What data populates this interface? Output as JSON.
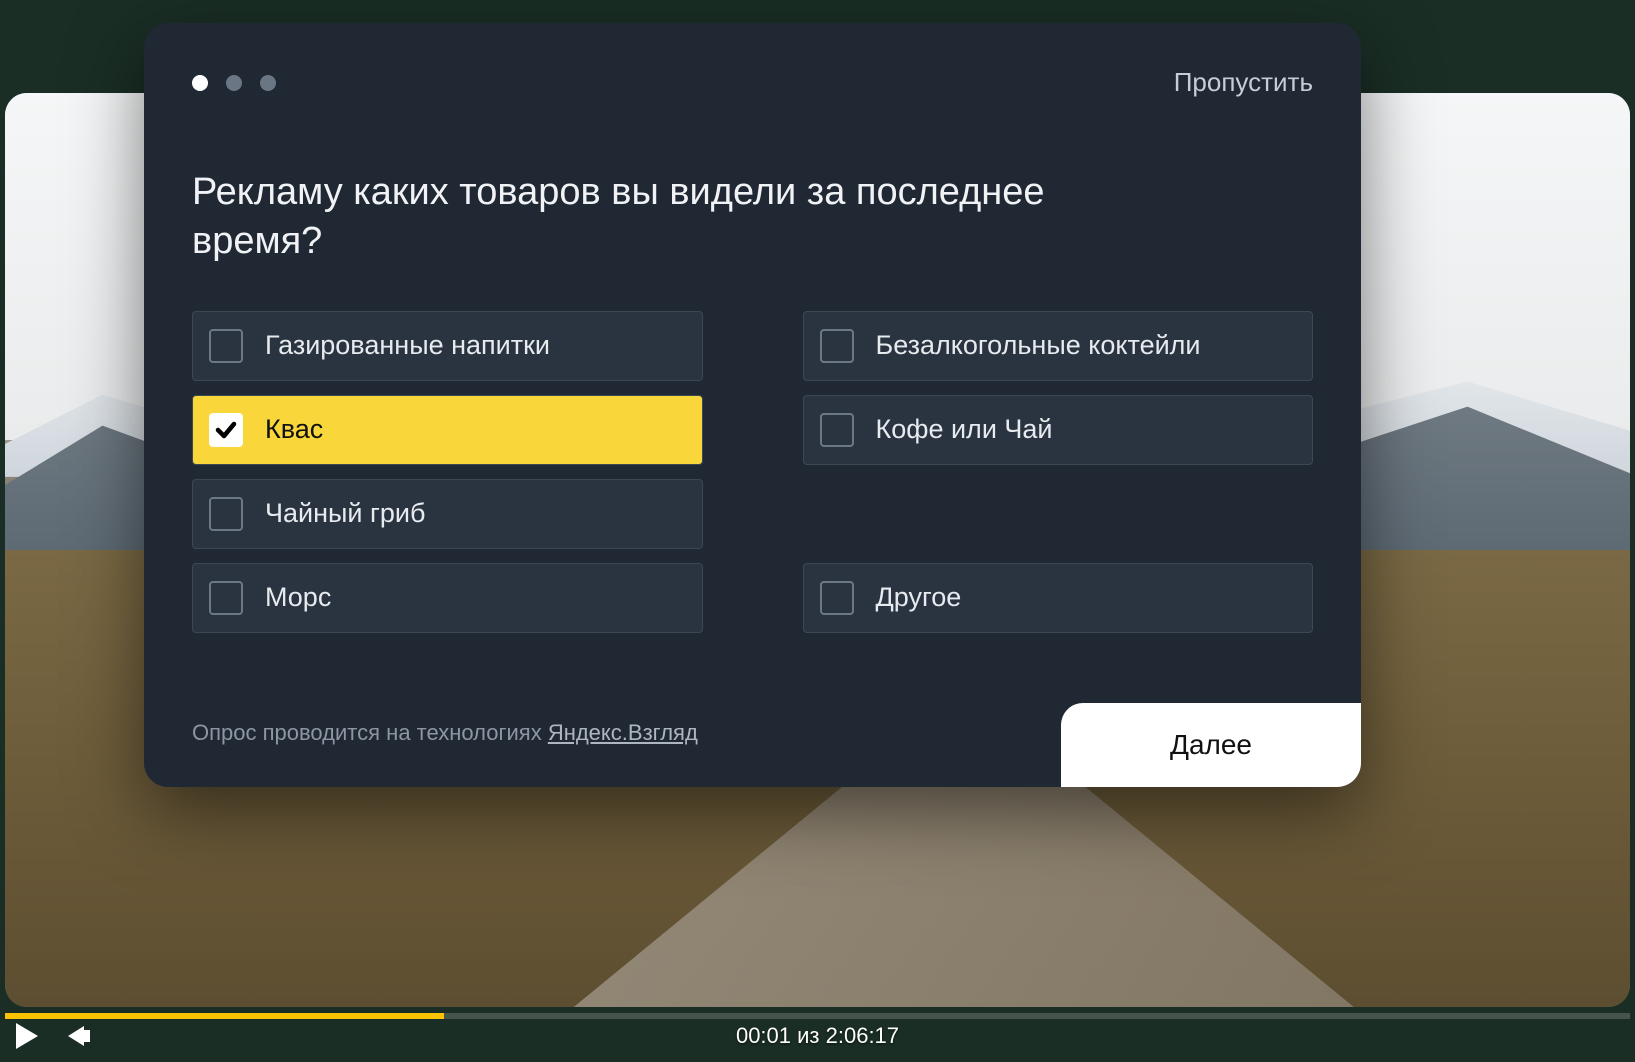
{
  "modal": {
    "skip_label": "Пропустить",
    "question": "Рекламу каких товаров вы видели за последнее время?",
    "options_left": [
      {
        "label": "Газированные напитки",
        "selected": false
      },
      {
        "label": "Квас",
        "selected": true
      },
      {
        "label": "Чайный гриб",
        "selected": false
      },
      {
        "label": "Морс",
        "selected": false
      }
    ],
    "options_right": [
      {
        "label": "Безалкогольные коктейли",
        "selected": false
      },
      {
        "label": "Кофе или Чай",
        "selected": false
      },
      {
        "label": "",
        "placeholder": true
      },
      {
        "label": "Другое",
        "selected": false
      }
    ],
    "footer_prefix": "Опрос проводится на технологиях ",
    "footer_link": "Яндекс.Взгляд",
    "next_label": "Далее",
    "progress_dots": {
      "total": 3,
      "active_index": 0
    }
  },
  "player": {
    "current_time": "00:01",
    "separator": " из ",
    "total_time": "2:06:17",
    "progress_percent": 27
  }
}
